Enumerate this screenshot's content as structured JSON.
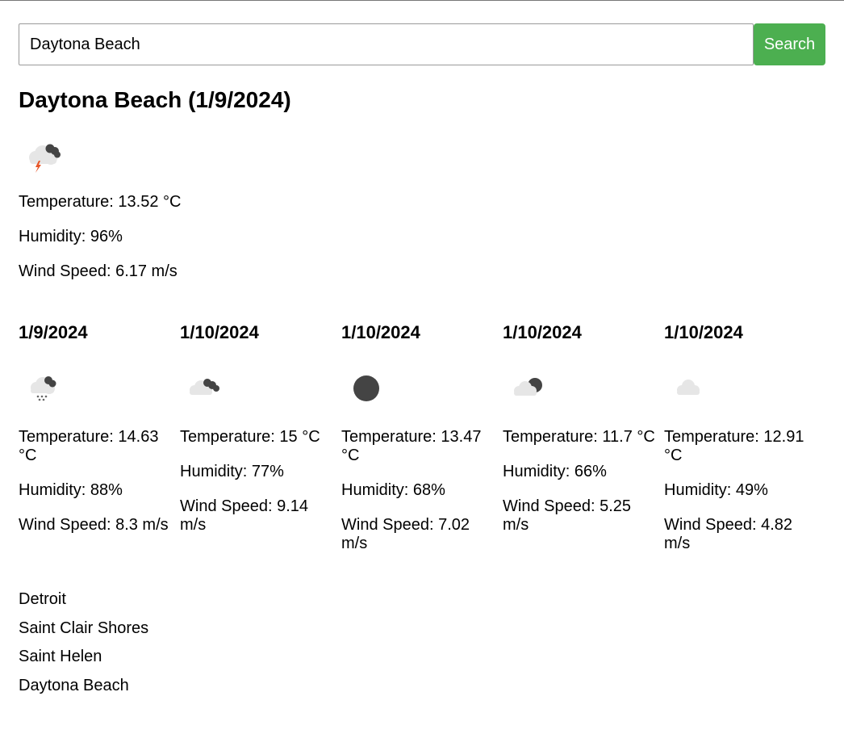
{
  "search": {
    "value": "Daytona Beach",
    "button_label": "Search"
  },
  "current": {
    "title": "Daytona Beach (1/9/2024)",
    "icon": "thunderstorm-icon",
    "temperature": "Temperature: 13.52 °C",
    "humidity": "Humidity: 96%",
    "wind": "Wind Speed: 6.17 m/s"
  },
  "forecast": [
    {
      "date": "1/9/2024",
      "icon": "rain-cloud-icon",
      "temperature": "Temperature: 14.63 °C",
      "humidity": "Humidity: 88%",
      "wind": "Wind Speed: 8.3 m/s"
    },
    {
      "date": "1/10/2024",
      "icon": "broken-clouds-icon",
      "temperature": "Temperature: 15 °C",
      "humidity": "Humidity: 77%",
      "wind": "Wind Speed: 9.14 m/s"
    },
    {
      "date": "1/10/2024",
      "icon": "clear-night-icon",
      "temperature": "Temperature: 13.47 °C",
      "humidity": "Humidity: 68%",
      "wind": "Wind Speed: 7.02 m/s"
    },
    {
      "date": "1/10/2024",
      "icon": "few-clouds-night-icon",
      "temperature": "Temperature: 11.7 °C",
      "humidity": "Humidity: 66%",
      "wind": "Wind Speed: 5.25 m/s"
    },
    {
      "date": "1/10/2024",
      "icon": "cloud-icon",
      "temperature": "Temperature: 12.91 °C",
      "humidity": "Humidity: 49%",
      "wind": "Wind Speed: 4.82 m/s"
    }
  ],
  "history": [
    "Detroit",
    "Saint Clair Shores",
    "Saint Helen",
    "Daytona Beach"
  ],
  "colors": {
    "button": "#4caf50",
    "cloud_light": "#e6e6e6",
    "cloud_dark": "#444444",
    "lightning": "#e8572a"
  }
}
